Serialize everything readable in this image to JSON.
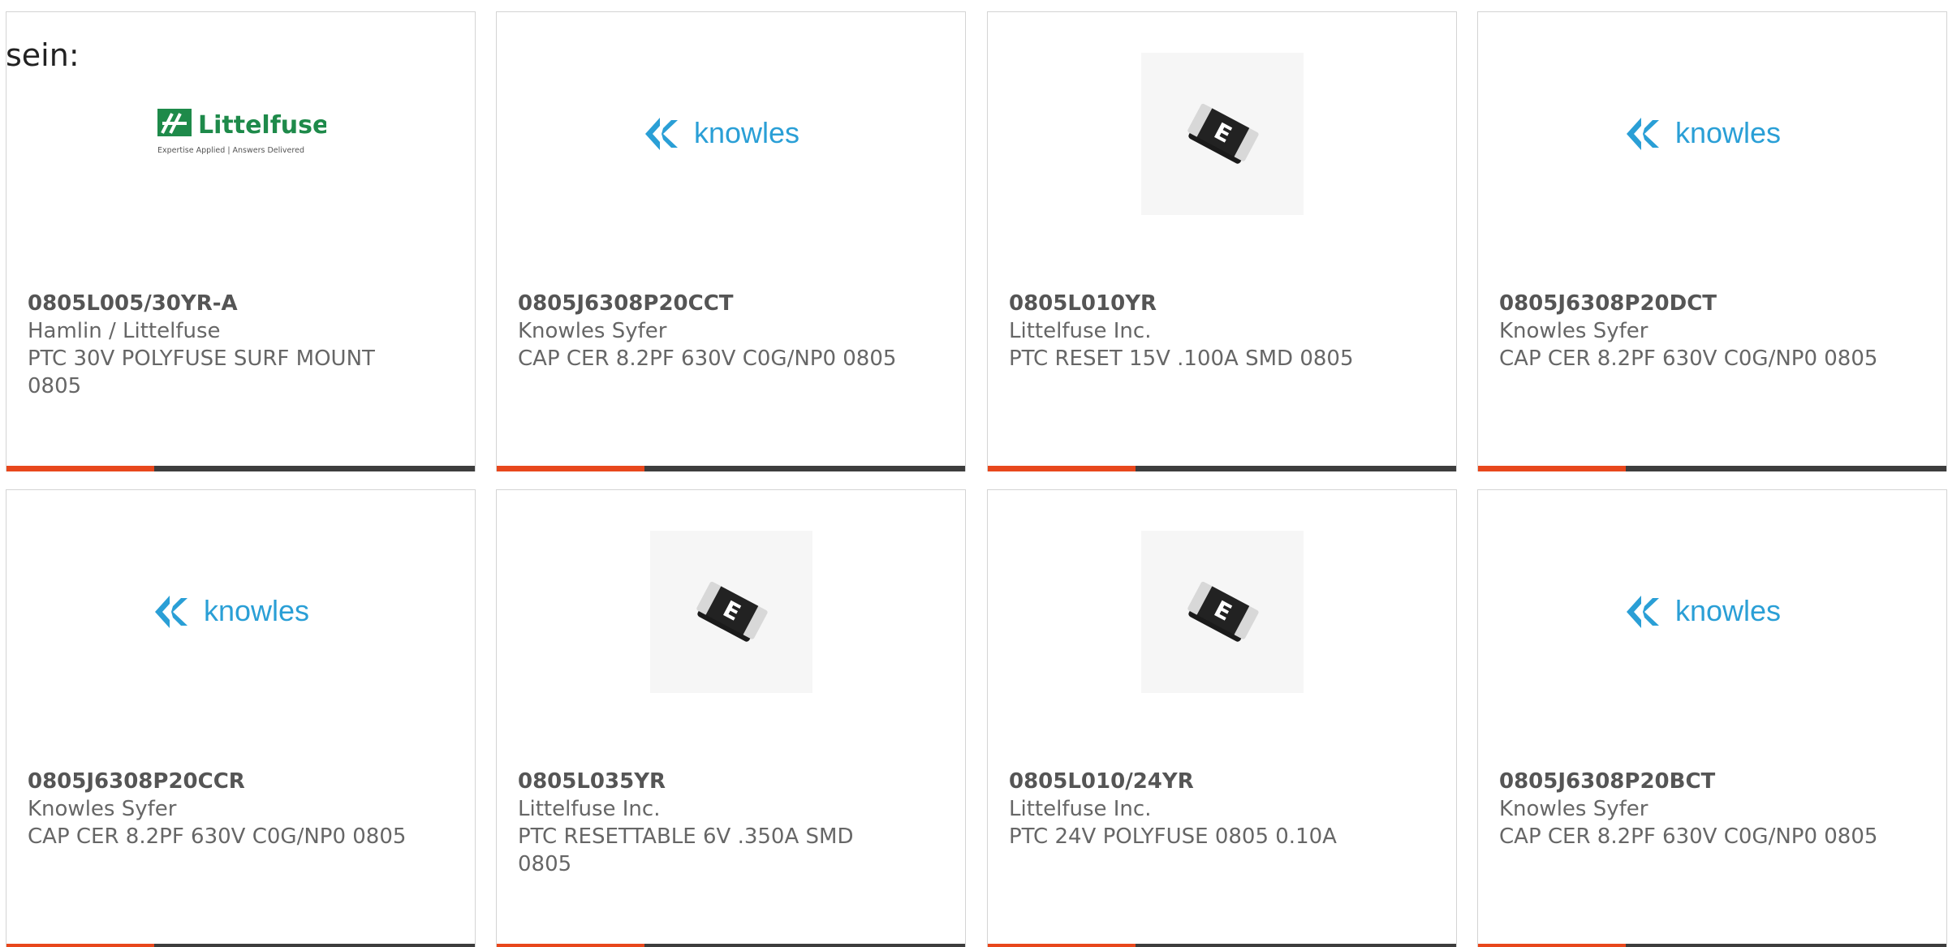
{
  "intro_text": "sein:",
  "colors": {
    "accent": "#e8471c",
    "bar": "#3d3d3d",
    "knowles_blue": "#2a9fd6",
    "littelfuse_green": "#1e8a4a"
  },
  "products": [
    {
      "part_number": "0805L005/30YR-A",
      "manufacturer": "Hamlin / Littelfuse",
      "description": "PTC 30V POLYFUSE SURF MOUNT 0805",
      "image": "littelfuse-logo",
      "logo_text": "Littelfuse",
      "logo_tagline": "Expertise Applied | Answers Delivered"
    },
    {
      "part_number": "0805J6308P20CCT",
      "manufacturer": "Knowles Syfer",
      "description": "CAP CER 8.2PF 630V C0G/NP0 0805",
      "image": "knowles-logo",
      "logo_text": "knowles"
    },
    {
      "part_number": "0805L010YR",
      "manufacturer": "Littelfuse Inc.",
      "description": "PTC RESET 15V .100A SMD 0805",
      "image": "fuse-photo",
      "chip_letter": "E"
    },
    {
      "part_number": "0805J6308P20DCT",
      "manufacturer": "Knowles Syfer",
      "description": "CAP CER 8.2PF 630V C0G/NP0 0805",
      "image": "knowles-logo",
      "logo_text": "knowles"
    },
    {
      "part_number": "0805J6308P20CCR",
      "manufacturer": "Knowles Syfer",
      "description": "CAP CER 8.2PF 630V C0G/NP0 0805",
      "image": "knowles-logo",
      "logo_text": "knowles"
    },
    {
      "part_number": "0805L035YR",
      "manufacturer": "Littelfuse Inc.",
      "description": "PTC RESETTABLE 6V .350A SMD 0805",
      "image": "fuse-photo",
      "chip_letter": "E"
    },
    {
      "part_number": "0805L010/24YR",
      "manufacturer": "Littelfuse Inc.",
      "description": "PTC 24V POLYFUSE 0805 0.10A",
      "image": "fuse-photo",
      "chip_letter": "E"
    },
    {
      "part_number": "0805J6308P20BCT",
      "manufacturer": "Knowles Syfer",
      "description": "CAP CER 8.2PF 630V C0G/NP0 0805",
      "image": "knowles-logo",
      "logo_text": "knowles"
    }
  ]
}
